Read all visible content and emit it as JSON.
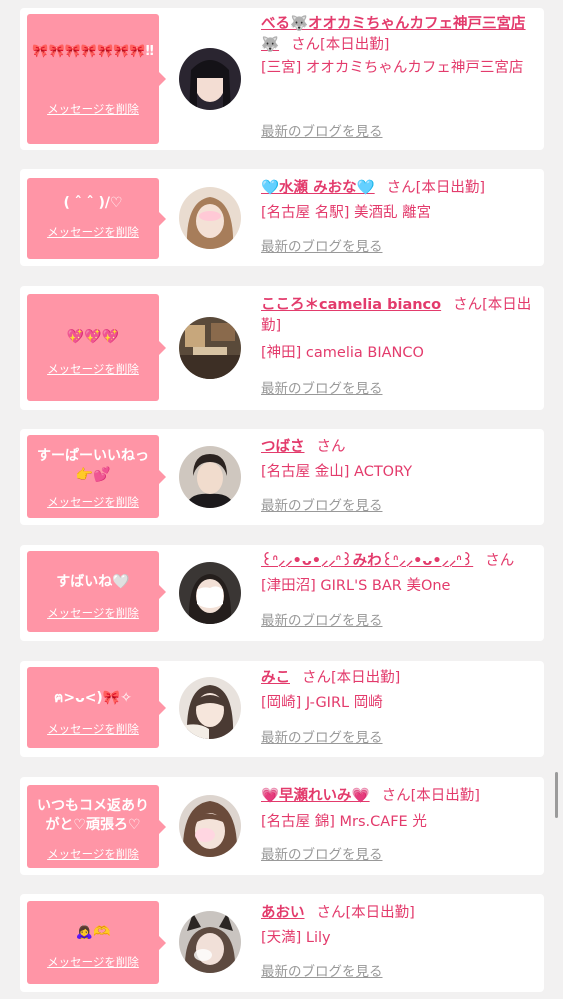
{
  "delete_label": "メッセージを削除",
  "blog_label": "最新のブログを見る",
  "colors": {
    "accent": "#e33b6c",
    "bubble": "#ff95a6",
    "background": "#f2f1f1",
    "muted": "#999999"
  },
  "cards": [
    {
      "message": "🎀🎀🎀🎀🎀🎀🎀‼︎",
      "name": "べる🐺オオカミちゃんカフェ神戸三宮店🐺",
      "suffix": "さん[本日出勤]",
      "shop": "[三宮] オオカミちゃんカフェ神戸三宮店"
    },
    {
      "message": "( ˆ ˆ )/♡",
      "name": "🩵水瀬 みおな🩵",
      "suffix": "さん[本日出勤]",
      "shop": "[名古屋 名駅] 美酒乱 離宮"
    },
    {
      "message": "💖💖💖",
      "name": "こころ＊camelia bianco",
      "suffix": "さん[本日出勤]",
      "shop": "[神田] camelia BIANCO"
    },
    {
      "message": "すーぱーいいねっ👉💕",
      "name": "つばさ",
      "suffix": "さん",
      "shop": "[名古屋 金山] ACTORY"
    },
    {
      "message": "すばいね🤍",
      "name": "꒰ᐢ⸝⸝•ᴗ•⸝⸝ᐢ꒱みわ꒰ᐢ⸝⸝•ᴗ•⸝⸝ᐢ꒱",
      "suffix": "さん",
      "shop": "[津田沼] GIRL'S BAR 美One"
    },
    {
      "message": "ฅ>ᴗ<)🎀✧",
      "name": "みこ",
      "suffix": "さん[本日出勤]",
      "shop": "[岡崎] J-GIRL 岡崎"
    },
    {
      "message": "いつもコメ返ありがと♡頑張ろ♡",
      "name": "💗早瀬れいみ💗",
      "suffix": "さん[本日出勤]",
      "shop": "[名古屋 錦] Mrs.CAFE 光"
    },
    {
      "message": "🙇‍♀️🫶",
      "name": "あおい",
      "suffix": "さん[本日出勤]",
      "shop": "[天満] Lily"
    }
  ]
}
